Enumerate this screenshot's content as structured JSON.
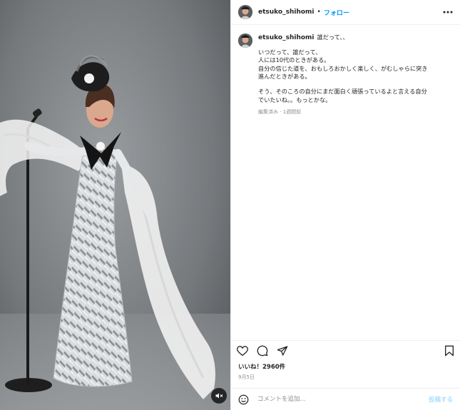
{
  "post": {
    "username": "etsuko_shihomi",
    "follow_label": "フォロー",
    "header_separator": "•",
    "caption": {
      "title": "誰だって、、",
      "lines": [
        "いつだって、誰だって、",
        "人には10代のときがある。",
        "自分の信じた道を、おもしろおかしく楽しく、がむしゃらに突き",
        "進んだときがある。"
      ],
      "lines2": [
        "そう、そのころの自分にまだ面白く頑張っているよと言える自分",
        "でいたいね。。もっとかな。"
      ],
      "meta": "編集済み · 1週間前"
    },
    "likes": "いいね！2960件",
    "date": "9月5日",
    "comment_placeholder": "コメントを追加...",
    "post_label": "投稿する"
  },
  "icons": {
    "more": "more-options-icon",
    "like": "heart-icon",
    "comment": "comment-icon",
    "share": "share-icon",
    "save": "bookmark-icon",
    "emoji": "emoji-icon",
    "mute": "audio-muted-icon"
  },
  "colors": {
    "link": "#0095f6",
    "muted": "#8e8e8e",
    "post_disabled": "#b2dffc"
  }
}
